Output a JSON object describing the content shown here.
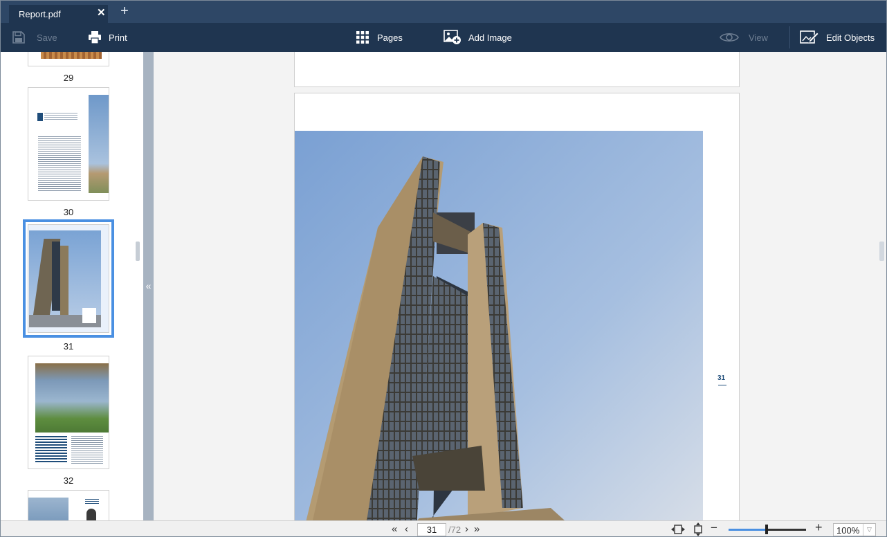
{
  "tabs": [
    {
      "title": "Report.pdf"
    }
  ],
  "toolbar": {
    "save_label": "Save",
    "print_label": "Print",
    "pages_label": "Pages",
    "add_image_label": "Add Image",
    "view_label": "View",
    "edit_objects_label": "Edit Objects"
  },
  "sidebar": {
    "thumbnails": [
      {
        "label": "29"
      },
      {
        "label": "30"
      },
      {
        "label": "31",
        "selected": true
      },
      {
        "label": "32"
      }
    ]
  },
  "document": {
    "current_page_number": "31"
  },
  "statusbar": {
    "current_page": "31",
    "total_pages": "/72",
    "zoom": "100%"
  },
  "colors": {
    "titlebar": "#2e4766",
    "toolbar": "#1f3550",
    "accent": "#4a90e2",
    "sky": "#8fb0dc",
    "building": "#b39a72"
  }
}
